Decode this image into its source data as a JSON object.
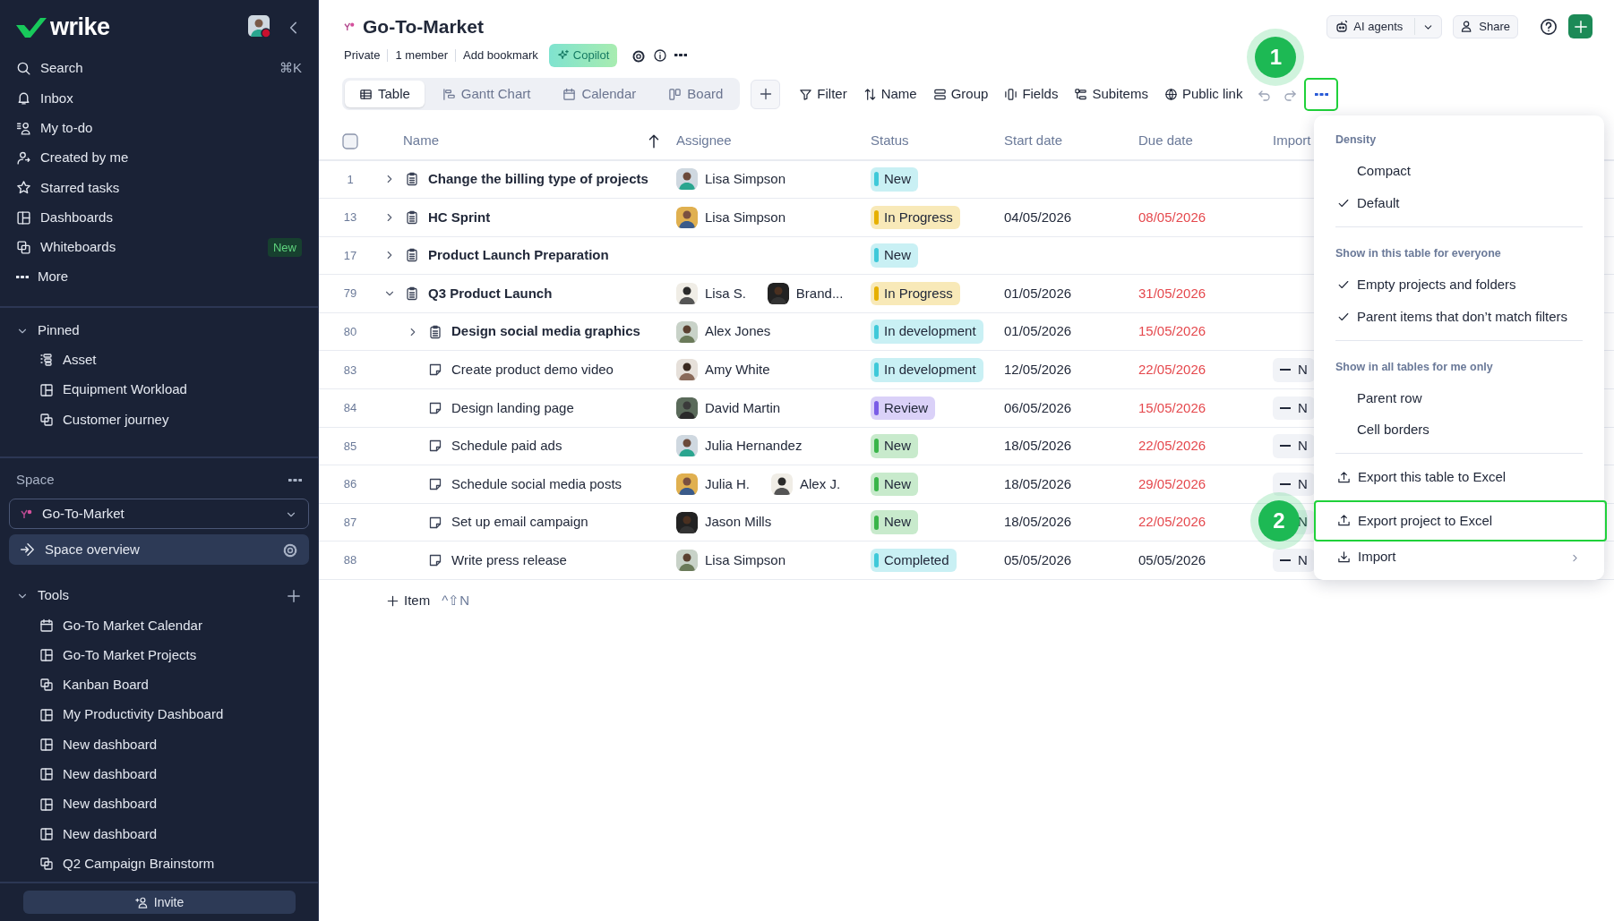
{
  "sidebar": {
    "logo": "wrike",
    "nav": [
      {
        "label": "Search",
        "shortcut": "⌘K"
      },
      {
        "label": "Inbox"
      },
      {
        "label": "My to-do"
      },
      {
        "label": "Created by me"
      },
      {
        "label": "Starred tasks"
      },
      {
        "label": "Dashboards"
      },
      {
        "label": "Whiteboards",
        "badge": "New"
      },
      {
        "label": "More"
      }
    ],
    "pinned": {
      "title": "Pinned",
      "expanded": true,
      "items": [
        "Asset",
        "Equipment Workload",
        "Customer journey"
      ]
    },
    "space": {
      "label": "Space",
      "selector": "Go-To-Market",
      "overview": {
        "label": "Space overview",
        "selected": true
      }
    },
    "tools": {
      "title": "Tools",
      "expanded": true,
      "items": [
        "Go-To Market Calendar",
        "Go-To Market Projects",
        "Kanban Board",
        "My Productivity Dashboard",
        "New dashboard",
        "New dashboard",
        "New dashboard",
        "New dashboard",
        "Q2 Campaign Brainstorm"
      ]
    },
    "invite": "Invite"
  },
  "header": {
    "title": "Go-To-Market",
    "meta": [
      "Private",
      "1 member",
      "Add bookmark"
    ],
    "copilot": "Copilot",
    "ai_agents": "AI agents",
    "share": "Share"
  },
  "toolbar": {
    "views": [
      {
        "label": "Table",
        "selected": true
      },
      {
        "label": "Gantt Chart",
        "selected": false
      },
      {
        "label": "Calendar",
        "selected": false
      },
      {
        "label": "Board",
        "selected": false
      }
    ],
    "actions": [
      "Filter",
      "Name",
      "Group",
      "Fields",
      "Subitems",
      "Public link"
    ],
    "more": {
      "highlighted": true,
      "callout": "1"
    }
  },
  "table": {
    "select_all": {
      "checked": false
    },
    "columns": [
      "Name",
      "Assignee",
      "Status",
      "Start date",
      "Due date",
      "Import"
    ],
    "rows": [
      {
        "number": "1",
        "kind": "project",
        "name": "Change the billing type of projects",
        "expanded": false,
        "assignees": [
          "Lisa Simpson"
        ],
        "status": {
          "label": "New",
          "color": "#3fc9d9"
        }
      },
      {
        "number": "13",
        "kind": "project",
        "name": "HC Sprint",
        "expanded": false,
        "assignees": [
          "Lisa Simpson"
        ],
        "status": {
          "label": "In Progress",
          "color": "#e6b000"
        },
        "start": "04/05/2026",
        "due": "08/05/2026",
        "overdue": true
      },
      {
        "number": "17",
        "kind": "project",
        "name": "Product Launch Preparation",
        "expanded": false,
        "status": {
          "label": "New",
          "color": "#3fc9d9"
        }
      },
      {
        "number": "79",
        "kind": "project",
        "name": "Q3 Product Launch",
        "expanded": true,
        "assignees": [
          "Lisa S.",
          "Brand..."
        ],
        "status": {
          "label": "In Progress",
          "color": "#e6b000"
        },
        "start": "01/05/2026",
        "due": "31/05/2026",
        "overdue": true,
        "children": [
          {
            "number": "80",
            "kind": "project",
            "name": "Design social media graphics",
            "expanded": false,
            "assignees": [
              "Alex Jones"
            ],
            "status": {
              "label": "In development",
              "color": "#3fc9d9"
            },
            "start": "01/05/2026",
            "due": "15/05/2026",
            "overdue": true
          },
          {
            "number": "83",
            "kind": "task",
            "name": "Create product demo video",
            "assignees": [
              "Amy White"
            ],
            "status": {
              "label": "In development",
              "color": "#3fc9d9"
            },
            "start": "12/05/2026",
            "due": "22/05/2026",
            "overdue": true,
            "importance": "N"
          },
          {
            "number": "84",
            "kind": "task",
            "name": "Design landing page",
            "assignees": [
              "David Martin"
            ],
            "status": {
              "label": "Review",
              "color": "#7a5ce6"
            },
            "start": "06/05/2026",
            "due": "15/05/2026",
            "overdue": true,
            "importance": "N"
          },
          {
            "number": "85",
            "kind": "task",
            "name": "Schedule paid ads",
            "assignees": [
              "Julia Hernandez"
            ],
            "status": {
              "label": "New",
              "color": "#3ab54a"
            },
            "start": "18/05/2026",
            "due": "22/05/2026",
            "overdue": true,
            "importance": "N"
          },
          {
            "number": "86",
            "kind": "task",
            "name": "Schedule social media posts",
            "assignees": [
              "Julia H.",
              "Alex J."
            ],
            "status": {
              "label": "New",
              "color": "#3ab54a"
            },
            "start": "18/05/2026",
            "due": "29/05/2026",
            "overdue": true,
            "importance": "N"
          },
          {
            "number": "87",
            "kind": "task",
            "name": "Set up email campaign",
            "assignees": [
              "Jason Mills"
            ],
            "status": {
              "label": "New",
              "color": "#3ab54a"
            },
            "start": "18/05/2026",
            "due": "22/05/2026",
            "overdue": true,
            "importance": "N"
          },
          {
            "number": "88",
            "kind": "task",
            "name": "Write press release",
            "assignees": [
              "Lisa Simpson"
            ],
            "status": {
              "label": "Completed",
              "color": "#3fc9d9"
            },
            "start": "05/05/2026",
            "due": "05/05/2026",
            "overdue": false,
            "importance": "N"
          }
        ]
      }
    ],
    "add_item": {
      "label": "Item",
      "shortcut": "^⇧N"
    }
  },
  "menu": {
    "sections": [
      {
        "heading": "Density",
        "items": [
          {
            "label": "Compact",
            "checked": false
          },
          {
            "label": "Default",
            "checked": true
          }
        ]
      },
      {
        "heading": "Show in this table for everyone",
        "items": [
          {
            "label": "Empty projects and folders",
            "checked": true
          },
          {
            "label": "Parent items that don’t match filters",
            "checked": true
          }
        ]
      },
      {
        "heading": "Show in all tables for me only",
        "items": [
          {
            "label": "Parent row",
            "checked": false
          },
          {
            "label": "Cell borders",
            "checked": false
          }
        ]
      }
    ],
    "actions": [
      {
        "label": "Export this table to Excel",
        "kind": "export",
        "highlighted": false
      },
      {
        "label": "Export project to Excel",
        "kind": "export",
        "highlighted": true,
        "callout": "2"
      },
      {
        "label": "Import",
        "kind": "import",
        "highlighted": false,
        "submenu": true
      }
    ]
  }
}
